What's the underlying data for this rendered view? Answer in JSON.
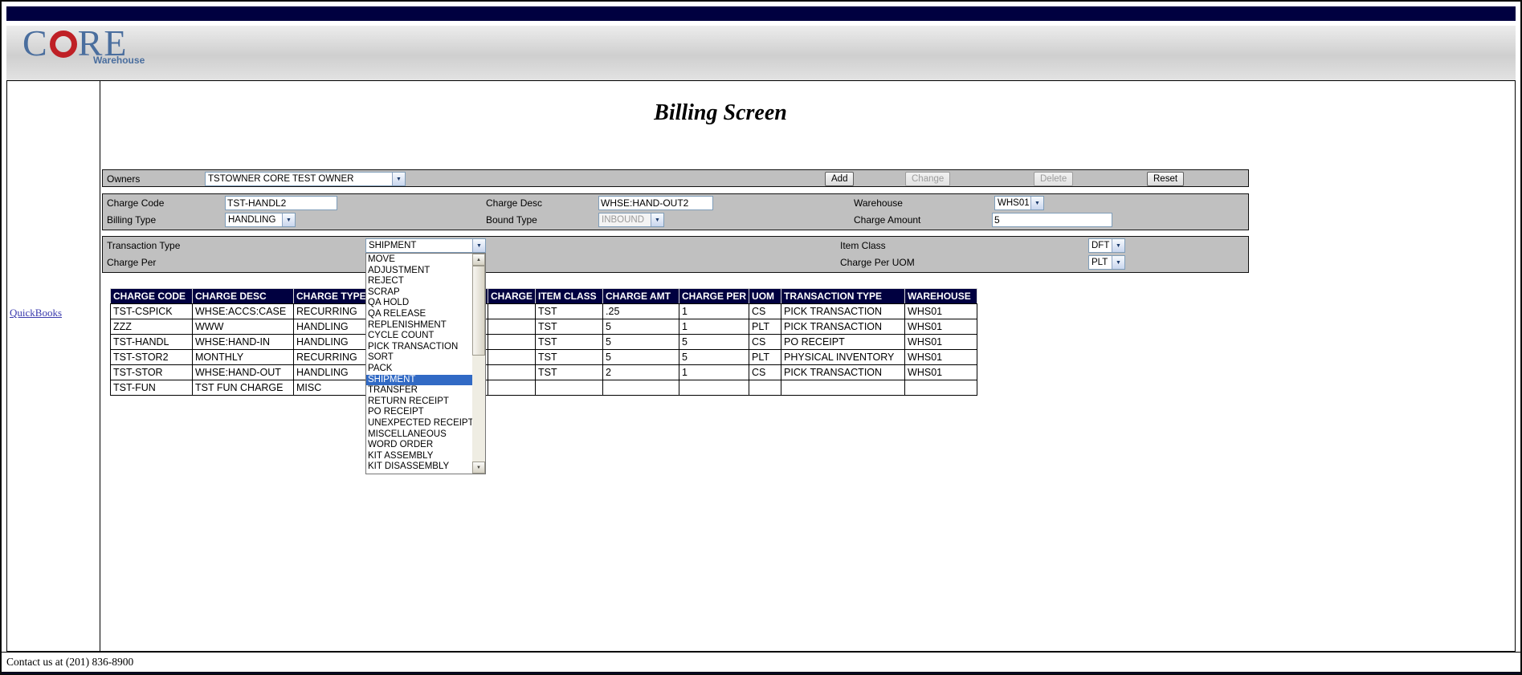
{
  "page": {
    "title": "Billing Screen",
    "footer": "Contact us at (201) 836-8900"
  },
  "logo": {
    "c": "C",
    "re": "RE",
    "subtitle": "Warehouse"
  },
  "sidebar": {
    "link": "QuickBooks"
  },
  "owners": {
    "label": "Owners",
    "selected": "TSTOWNER CORE TEST OWNER",
    "buttons": [
      {
        "label": "Add",
        "enabled": true
      },
      {
        "label": "Change",
        "enabled": false
      },
      {
        "label": "Delete",
        "enabled": false
      },
      {
        "label": "Reset",
        "enabled": true
      }
    ]
  },
  "form": {
    "charge_code": {
      "label": "Charge Code",
      "value": "TST-HANDL2"
    },
    "charge_desc": {
      "label": "Charge Desc",
      "value": "WHSE:HAND-OUT2"
    },
    "warehouse": {
      "label": "Warehouse",
      "value": "WHS01"
    },
    "billing_type": {
      "label": "Billing Type",
      "value": "HANDLING"
    },
    "bound_type": {
      "label": "Bound Type",
      "value": "INBOUND",
      "disabled": true
    },
    "charge_amount": {
      "label": "Charge Amount",
      "value": "5"
    },
    "transaction_type": {
      "label": "Transaction Type",
      "value": "SHIPMENT"
    },
    "item_class": {
      "label": "Item Class",
      "value": "DFT"
    },
    "charge_per": {
      "label": "Charge Per"
    },
    "charge_per_uom": {
      "label": "Charge Per UOM",
      "value": "PLT"
    }
  },
  "dropdown": {
    "selected": "SHIPMENT",
    "options": [
      "MOVE",
      "ADJUSTMENT",
      "REJECT",
      "SCRAP",
      "QA HOLD",
      "QA RELEASE",
      "REPLENISHMENT",
      "CYCLE COUNT",
      "PICK TRANSACTION",
      "SORT",
      "PACK",
      "SHIPMENT",
      "TRANSFER",
      "RETURN RECEIPT",
      "PO RECEIPT",
      "UNEXPECTED RECEIPT",
      "MISCELLANEOUS",
      "WORD ORDER",
      "KIT ASSEMBLY",
      "KIT DISASSEMBLY"
    ]
  },
  "table": {
    "headers": [
      "CHARGE CODE",
      "CHARGE DESC",
      "CHARGE TYPE",
      "",
      "CHARGE",
      "ITEM CLASS",
      "CHARGE AMT",
      "CHARGE PER",
      "UOM",
      "TRANSACTION TYPE",
      "WAREHOUSE"
    ],
    "rows": [
      [
        "TST-CSPICK",
        "WHSE:ACCS:CASE",
        "RECURRING",
        "",
        "",
        "TST",
        ".25",
        "1",
        "CS",
        "PICK TRANSACTION",
        "WHS01"
      ],
      [
        "ZZZ",
        "WWW",
        "HANDLING",
        "",
        "",
        "TST",
        "5",
        "1",
        "PLT",
        "PICK TRANSACTION",
        "WHS01"
      ],
      [
        "TST-HANDL",
        "WHSE:HAND-IN",
        "HANDLING",
        "",
        "",
        "TST",
        "5",
        "5",
        "CS",
        "PO RECEIPT",
        "WHS01"
      ],
      [
        "TST-STOR2",
        "MONTHLY",
        "RECURRING",
        "",
        "",
        "TST",
        "5",
        "5",
        "PLT",
        "PHYSICAL INVENTORY",
        "WHS01"
      ],
      [
        "TST-STOR",
        "WHSE:HAND-OUT",
        "HANDLING",
        "",
        "",
        "TST",
        "2",
        "1",
        "CS",
        "PICK TRANSACTION",
        "WHS01"
      ],
      [
        "TST-FUN",
        "TST FUN CHARGE",
        "MISC",
        "",
        "",
        "",
        "",
        "",
        "",
        "",
        ""
      ]
    ]
  },
  "colors": {
    "navy_bar": "#000040",
    "form_silver": "#c0c0c0",
    "table_header": "#000040",
    "dropdown_highlight": "#316ac5",
    "logo_blue": "#4a6e9e",
    "logo_red": "#bf2026",
    "link": "#3a3aad"
  }
}
